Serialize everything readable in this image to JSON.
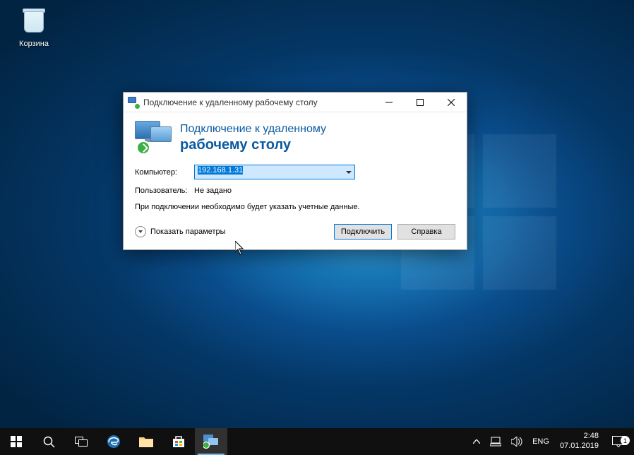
{
  "desktop": {
    "recycle_bin_label": "Корзина"
  },
  "dialog": {
    "title": "Подключение к удаленному рабочему столу",
    "heading_line1": "Подключение к удаленному",
    "heading_line2": "рабочему столу",
    "labels": {
      "computer": "Компьютер:",
      "user": "Пользователь:"
    },
    "values": {
      "computer": "192.168.1.31",
      "user": "Не задано"
    },
    "hint": "При подключении необходимо будет указать учетные данные.",
    "show_options": "Показать параметры",
    "buttons": {
      "connect": "Подключить",
      "help": "Справка"
    }
  },
  "taskbar": {
    "lang": "ENG",
    "time": "2:48",
    "date": "07.01.2019",
    "notification_count": "1"
  }
}
